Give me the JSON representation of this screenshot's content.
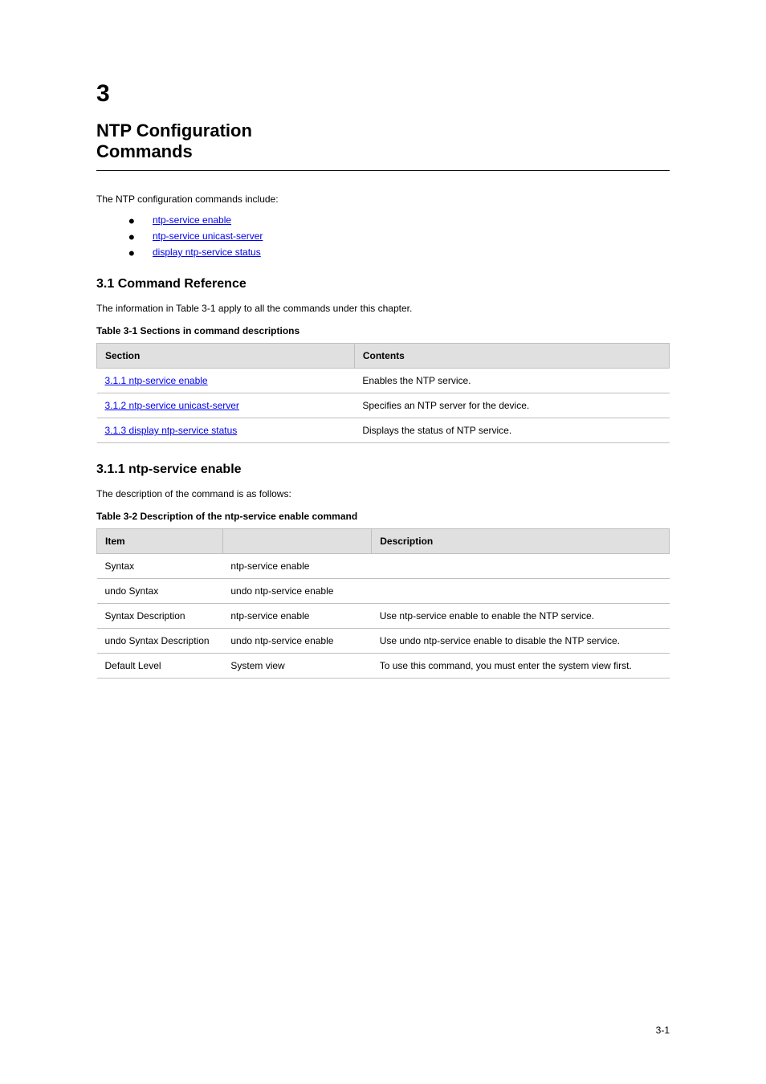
{
  "chapter_num": "3",
  "chapter_title_line1": "NTP Configuration",
  "chapter_title_line2": "Commands",
  "intro_text": "The NTP configuration commands include:",
  "bullets": [
    {
      "text": "ntp-service enable"
    },
    {
      "text": "ntp-service unicast-server"
    },
    {
      "text": "display ntp-service status"
    }
  ],
  "section1": {
    "heading": "3.1  Command Reference",
    "desc": "The information in Table 3-1 apply to all the commands under this chapter.",
    "table_caption": "Table 3-1 Sections in command descriptions",
    "table": {
      "headers": [
        "Section",
        "Contents"
      ],
      "rows": [
        {
          "link": "3.1.1 ntp-service enable",
          "desc": "Enables the NTP service."
        },
        {
          "link": "3.1.2 ntp-service unicast-server",
          "desc": "Specifies an NTP server for the device."
        },
        {
          "link": "3.1.3 display ntp-service status",
          "desc": "Displays the status of NTP service."
        }
      ]
    }
  },
  "section2": {
    "heading": "3.1.1  ntp-service enable",
    "desc": "The description of the command is as follows:",
    "table_caption": "Table 3-2 Description of the ntp-service enable command",
    "table": {
      "headers": [
        "Item",
        "",
        "Description"
      ],
      "rows": [
        [
          "Syntax",
          "ntp-service enable",
          ""
        ],
        [
          "undo Syntax",
          "undo ntp-service enable",
          ""
        ],
        [
          "Syntax Description",
          "ntp-service enable",
          "Use ntp-service enable to enable the NTP service."
        ],
        [
          "undo Syntax Description",
          "undo ntp-service enable",
          "Use undo ntp-service enable to disable the NTP service."
        ],
        [
          "Default Level",
          "System view",
          "To use this command, you must enter the system view first."
        ]
      ]
    }
  },
  "footer_page": "3-1"
}
